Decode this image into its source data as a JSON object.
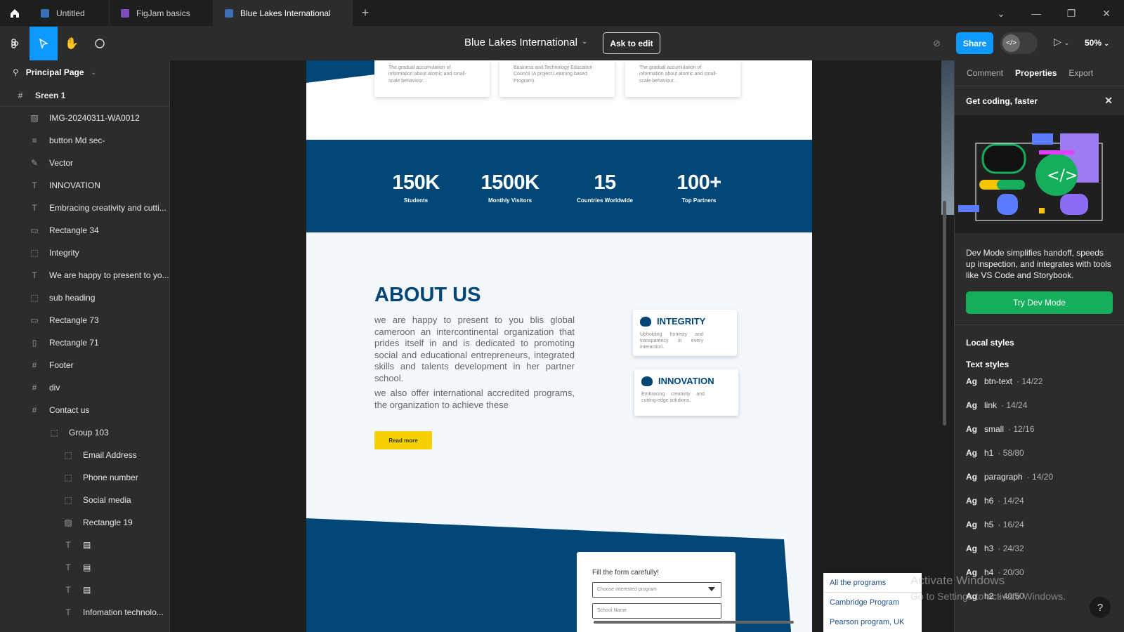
{
  "tabs": [
    {
      "label": "Untitled",
      "color": "#3b6fb6"
    },
    {
      "label": "FigJam basics",
      "color": "#7c4dbb"
    },
    {
      "label": "Blue Lakes International",
      "color": "#3b6fb6"
    }
  ],
  "toolbar": {
    "doc_title": "Blue Lakes International",
    "ask_label": "Ask to edit",
    "share_label": "Share",
    "zoom": "50%"
  },
  "layers": {
    "page_name": "Principal Page",
    "items": [
      {
        "icon": "frame-icon",
        "glyph": "#",
        "label": "Sreen 1",
        "indent": 0
      },
      {
        "icon": "image-icon",
        "glyph": "▨",
        "label": "IMG-20240311-WA0012",
        "indent": 1
      },
      {
        "icon": "text-lines-icon",
        "glyph": "≡",
        "label": "button Md sec-",
        "indent": 1
      },
      {
        "icon": "vector-icon",
        "glyph": "✎",
        "label": "Vector",
        "indent": 1
      },
      {
        "icon": "text-icon",
        "glyph": "T",
        "label": "INNOVATION",
        "indent": 1
      },
      {
        "icon": "text-icon",
        "glyph": "T",
        "label": "Embracing creativity and cutti...",
        "indent": 1
      },
      {
        "icon": "rectangle-icon",
        "glyph": "▭",
        "label": "Rectangle 34",
        "indent": 1
      },
      {
        "icon": "group-icon",
        "glyph": "⬚",
        "label": "Integrity",
        "indent": 1
      },
      {
        "icon": "text-icon",
        "glyph": "T",
        "label": "We are happy to present to yo...",
        "indent": 1
      },
      {
        "icon": "group-icon",
        "glyph": "⬚",
        "label": "sub heading",
        "indent": 1
      },
      {
        "icon": "rectangle-icon",
        "glyph": "▭",
        "label": "Rectangle 73",
        "indent": 1
      },
      {
        "icon": "rectangle-icon",
        "glyph": "▯",
        "label": "Rectangle 71",
        "indent": 1
      },
      {
        "icon": "frame-icon",
        "glyph": "#",
        "label": "Footer",
        "indent": 1
      },
      {
        "icon": "frame-icon",
        "glyph": "#",
        "label": "div",
        "indent": 1
      },
      {
        "icon": "frame-icon",
        "glyph": "#",
        "label": "Contact us",
        "indent": 1
      },
      {
        "icon": "group-icon",
        "glyph": "⬚",
        "label": "Group 103",
        "indent": 2
      },
      {
        "icon": "group-icon",
        "glyph": "⬚",
        "label": "Email Address",
        "indent": 3
      },
      {
        "icon": "group-icon",
        "glyph": "⬚",
        "label": "Phone number",
        "indent": 3
      },
      {
        "icon": "group-icon",
        "glyph": "⬚",
        "label": "Social media",
        "indent": 3
      },
      {
        "icon": "image-icon",
        "glyph": "▨",
        "label": "Rectangle 19",
        "indent": 3
      },
      {
        "icon": "text-icon",
        "glyph": "T",
        "label": "▤",
        "indent": 3
      },
      {
        "icon": "text-icon",
        "glyph": "T",
        "label": "▤",
        "indent": 3
      },
      {
        "icon": "text-icon",
        "glyph": "T",
        "label": "▤",
        "indent": 3
      },
      {
        "icon": "text-icon",
        "glyph": "T",
        "label": "Infomation technolo...",
        "indent": 3
      }
    ]
  },
  "canvas": {
    "top_cards": [
      "The gradual accumulation of information about atomic and small-scale behaviour...",
      "Business and Technology Education Council (A project Learning based Program).",
      "The gradual accumulation of information about atomic and small-scale behaviour..."
    ],
    "stats": [
      {
        "num": "150K",
        "label": "Students"
      },
      {
        "num": "1500K",
        "label": "Monthly Visitors"
      },
      {
        "num": "15",
        "label": "Countries  Worldwide"
      },
      {
        "num": "100+",
        "label": "Top Partners"
      }
    ],
    "about_title": "ABOUT US",
    "about_p1": "we are happy to present to you blis global cameroon an intercontinental organization that prides itself in and is dedicated to promoting social and educational entrepreneurs, integrated skills and talents development in her partner school.",
    "about_p2": "we also offer international accredited programs, the organization to achieve these",
    "read_more": "Read more",
    "integrity": {
      "title": "INTEGRITY",
      "desc": "Upholding honesty and transparency in every interaction."
    },
    "innovation": {
      "title": "INNOVATION",
      "desc": "Embracing creativity and cutting-edge solutions."
    },
    "form_title": "Fill the form carefully!",
    "form_select_placeholder": "Choose interested program",
    "form_school_placeholder": "School Name",
    "programs": [
      "All the programs",
      "Cambridge Program",
      "Pearson program, UK"
    ],
    "brand_blue": "#004677",
    "accent_yellow": "#f5d100"
  },
  "right": {
    "tabs": [
      "Comment",
      "Properties",
      "Export"
    ],
    "banner_title": "Get coding, faster",
    "dev_text": "Dev Mode simplifies handoff, speeds up inspection, and integrates with tools like VS Code and Storybook.",
    "try_label": "Try Dev Mode",
    "local_styles": "Local styles",
    "text_styles": "Text styles",
    "styles": [
      {
        "name": "btn-text",
        "meta": "· 14/22"
      },
      {
        "name": "link",
        "meta": "· 14/24"
      },
      {
        "name": "small",
        "meta": "· 12/16"
      },
      {
        "name": "h1",
        "meta": "· 58/80"
      },
      {
        "name": "paragraph",
        "meta": "· 14/20"
      },
      {
        "name": "h6",
        "meta": "· 14/24"
      },
      {
        "name": "h5",
        "meta": "· 16/24"
      },
      {
        "name": "h3",
        "meta": "· 24/32"
      },
      {
        "name": "h4",
        "meta": "· 20/30"
      },
      {
        "name": "h2",
        "meta": "· 40/50"
      }
    ]
  },
  "watermark": {
    "line1": "Activate Windows",
    "line2": "Go to Settings to activate Windows."
  }
}
